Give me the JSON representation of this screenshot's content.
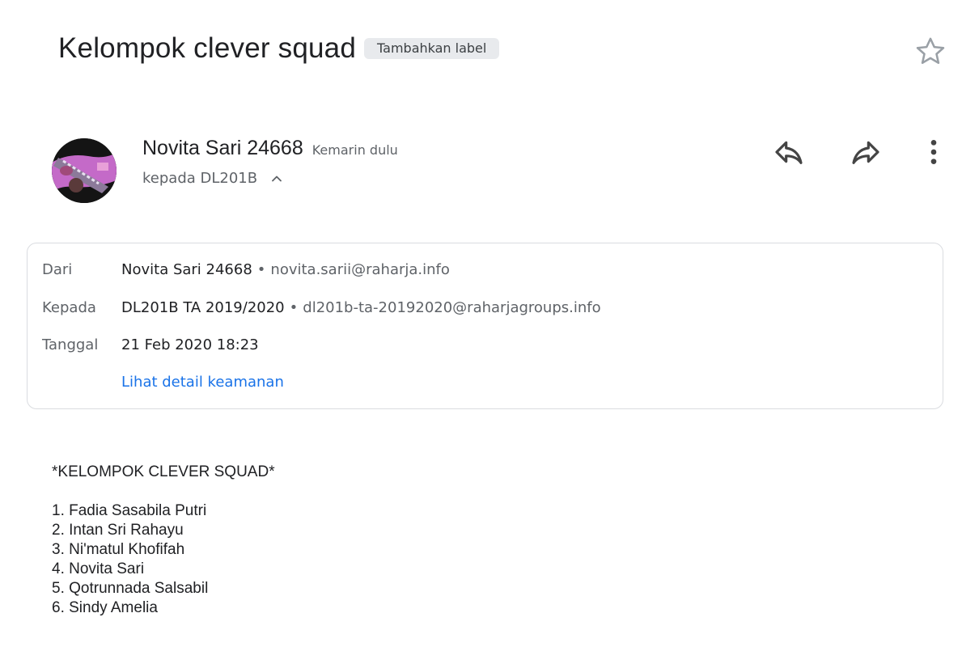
{
  "subject": "Kelompok clever squad",
  "label_chip": "Tambahkan label",
  "sender": {
    "name": "Novita Sari 24668",
    "time": "Kemarin dulu",
    "to_summary": "kepada DL201B"
  },
  "details": {
    "from_label": "Dari",
    "from_name": "Novita Sari 24668",
    "from_email": "novita.sarii@raharja.info",
    "to_label": "Kepada",
    "to_name": "DL201B TA 2019/2020",
    "to_email": "dl201b-ta-20192020@raharjagroups.info",
    "date_label": "Tanggal",
    "date_value": "21 Feb 2020 18:23",
    "security_link": "Lihat detail keamanan",
    "separator": "•"
  },
  "body": {
    "title": "*KELOMPOK CLEVER SQUAD*",
    "members": [
      "1. Fadia Sasabila Putri",
      "2. Intan Sri Rahayu",
      "3. Ni'matul Khofifah",
      "4. Novita Sari",
      "5. Qotrunnada Salsabil",
      "6. Sindy Amelia"
    ]
  },
  "icons": {
    "star": "star-outline-icon",
    "reply": "reply-icon",
    "forward": "forward-icon",
    "more": "more-vert-icon",
    "collapse": "chevron-up-icon"
  },
  "colors": {
    "link": "#1a73e8",
    "chip_bg": "#e8eaed",
    "secondary_text": "#5f6368"
  }
}
